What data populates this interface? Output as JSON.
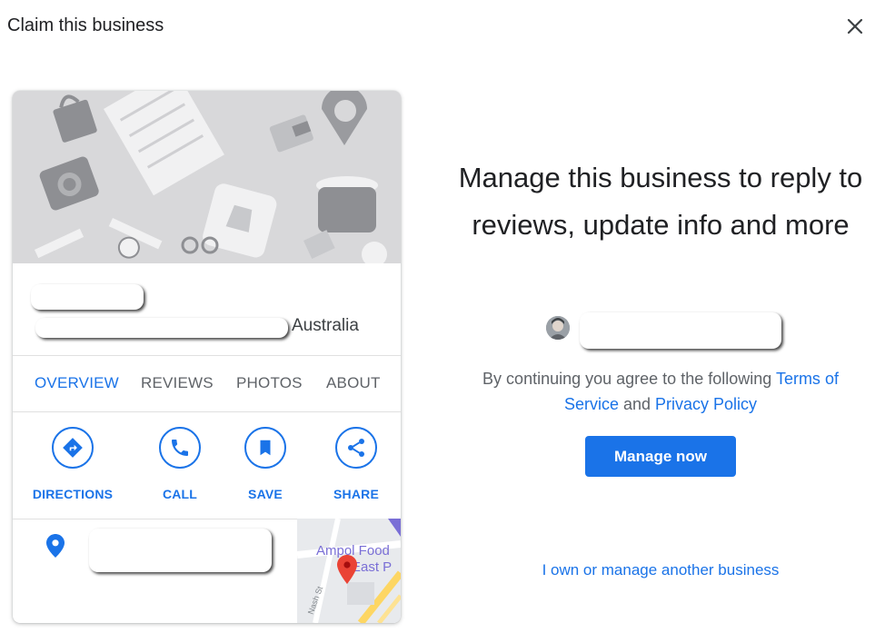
{
  "dialog": {
    "title": "Claim this business"
  },
  "card": {
    "address_suffix": "Australia",
    "tabs": [
      {
        "label": "OVERVIEW",
        "active": true
      },
      {
        "label": "REVIEWS",
        "active": false
      },
      {
        "label": "PHOTOS",
        "active": false
      },
      {
        "label": "ABOUT",
        "active": false
      }
    ],
    "actions": [
      {
        "label": "DIRECTIONS",
        "icon": "directions-icon"
      },
      {
        "label": "CALL",
        "icon": "phone-icon"
      },
      {
        "label": "SAVE",
        "icon": "bookmark-icon"
      },
      {
        "label": "SHARE",
        "icon": "share-icon"
      }
    ],
    "map": {
      "place_line1": "Ampol Food",
      "place_line2": "East P",
      "street": "Nash St"
    }
  },
  "panel": {
    "headline": "Manage this business to reply to reviews, update info and more",
    "consent_prefix": "By continuing you agree to the following ",
    "terms_link": "Terms of Service",
    "consent_middle": " and ",
    "privacy_link": "Privacy Policy",
    "manage_button": "Manage now",
    "other_business_link": "I own or manage another business"
  },
  "colors": {
    "accent": "#1a73e8",
    "text_primary": "#202124",
    "text_secondary": "#5f6368",
    "map_pin": "#ea4335"
  }
}
